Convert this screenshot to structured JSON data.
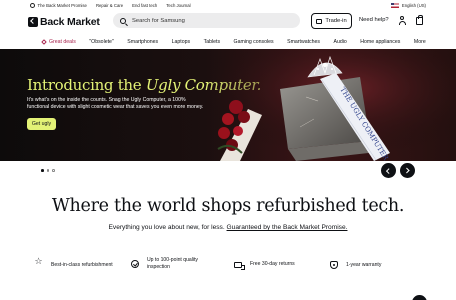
{
  "utility": {
    "items": [
      {
        "label": "The Back Market Promise"
      },
      {
        "label": "Repair & Care"
      },
      {
        "label": "End fast tech"
      },
      {
        "label": "Tech Journal"
      }
    ],
    "language": "English (US)"
  },
  "header": {
    "logo": "Back Market",
    "search_placeholder": "Search for Samsung",
    "trade_in": "Trade-in",
    "help": "Need help?"
  },
  "nav": {
    "items": [
      {
        "label": "Great deals"
      },
      {
        "label": "\"Obsolete\""
      },
      {
        "label": "Smartphones"
      },
      {
        "label": "Laptops"
      },
      {
        "label": "Tablets"
      },
      {
        "label": "Gaming consoles"
      },
      {
        "label": "Smartwatches"
      },
      {
        "label": "Audio"
      },
      {
        "label": "Home appliances"
      },
      {
        "label": "More"
      }
    ]
  },
  "hero": {
    "title_plain": "Introducing the ",
    "title_italic": "Ugly Computer.",
    "description": "It's what's on the inside the counts. Snag the Ugly Computer, a 100% functional device with slight cosmetic wear that saves you even more money.",
    "cta": "Get ugly",
    "sash_text": "THE UGLY COMPUTER"
  },
  "carousel": {
    "slides": 3,
    "active": 1
  },
  "main": {
    "headline": "Where the world shops refurbished tech.",
    "subline_text": "Everything you love about new, for less. ",
    "subline_link": "Guaranteed by the Back Market Promise."
  },
  "features": [
    {
      "label": "Best-in-class refurbishment",
      "icon": "star-icon"
    },
    {
      "label": "Up to 100-point quality inspection",
      "icon": "check-circle-icon"
    },
    {
      "label": "Free 30-day returns",
      "icon": "truck-icon"
    },
    {
      "label": "1-year warranty",
      "icon": "shield-icon"
    }
  ],
  "colors": {
    "accent": "#e3f276",
    "deal": "#a8244e",
    "text": "#0e1014",
    "hero_bg": "#1b0f0f"
  }
}
